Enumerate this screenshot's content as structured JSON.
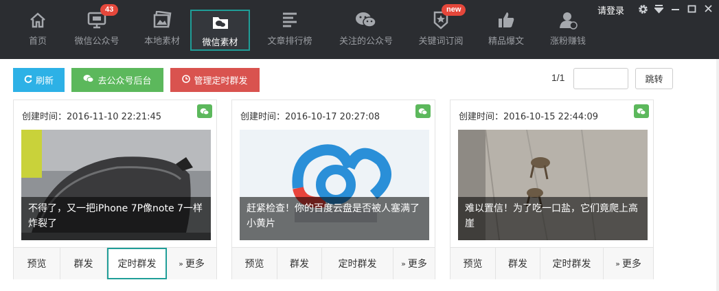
{
  "nav": {
    "items": [
      {
        "label": "首页",
        "icon": "home-icon"
      },
      {
        "label": "微信公众号",
        "icon": "monitor-icon",
        "badge": "43"
      },
      {
        "label": "本地素材",
        "icon": "image-icon"
      },
      {
        "label": "微信素材",
        "icon": "folder-wechat-icon",
        "active": true
      },
      {
        "label": "文章排行榜",
        "icon": "list-icon"
      },
      {
        "label": "关注的公众号",
        "icon": "wechat-icon"
      },
      {
        "label": "关键词订阅",
        "icon": "star-badge-icon",
        "badge": "new"
      },
      {
        "label": "精品爆文",
        "icon": "thumbs-up-icon"
      },
      {
        "label": "涨粉赚钱",
        "icon": "user-money-icon"
      }
    ],
    "login": "请登录"
  },
  "toolbar": {
    "refresh": "刷新",
    "backend": "去公众号后台",
    "schedule": "管理定时群发"
  },
  "pager": {
    "page": "1/1",
    "jump": "跳转",
    "input_value": ""
  },
  "cards": [
    {
      "created": "创建时间：2016-11-10 22:21:45",
      "title": "不得了，又一把iPhone 7P像note 7一样炸裂了",
      "actions": [
        "预览",
        "群发",
        "定时群发",
        "更多"
      ]
    },
    {
      "created": "创建时间：2016-10-17 20:27:08",
      "title": "赶紧检查！你的百度云盘是否被人塞满了小黄片",
      "actions": [
        "预览",
        "群发",
        "定时群发",
        "更多"
      ]
    },
    {
      "created": "创建时间：2016-10-15 22:44:09",
      "title": "难以置信！为了吃一口盐，它们竟爬上高崖",
      "actions": [
        "预览",
        "群发",
        "定时群发",
        "更多"
      ]
    }
  ],
  "colors": {
    "nav_bg": "#2b2d31",
    "accent": "#1f9e98",
    "refresh": "#2db1e6",
    "green": "#5cb85c",
    "red": "#d9534f",
    "badge": "#e5473b"
  }
}
